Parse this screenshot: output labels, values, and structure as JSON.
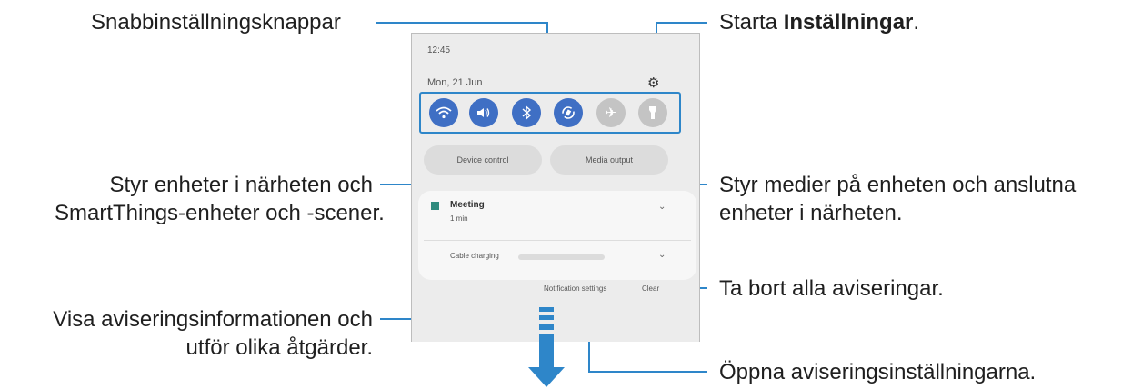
{
  "callouts": {
    "quick_buttons": "Snabbinställningsknappar",
    "settings_prefix": "Starta ",
    "settings_bold": "Inställningar",
    "settings_suffix": ".",
    "nearby_line1": "Styr enheter i närheten och",
    "nearby_line2": "SmartThings-enheter och -scener.",
    "media_line1": "Styr medier på enheten och anslutna",
    "media_line2": "enheter i närheten.",
    "clear": "Ta bort alla aviseringar.",
    "notif_info_line1": "Visa aviseringsinformationen och",
    "notif_info_line2": "utför olika åtgärder.",
    "notif_settings": "Öppna aviseringsinställningarna."
  },
  "panel": {
    "time": "12:45",
    "date": "Mon, 21 Jun",
    "device_control": "Device control",
    "media_output": "Media output",
    "notif_title": "Meeting",
    "notif_sub": "1 min",
    "charging": "Cable charging",
    "notification_settings": "Notification settings",
    "clear": "Clear"
  },
  "quick_buttons": [
    {
      "icon": "wifi-icon",
      "state": "on"
    },
    {
      "icon": "sound-icon",
      "state": "on"
    },
    {
      "icon": "bluetooth-icon",
      "state": "on"
    },
    {
      "icon": "auto-rotate-icon",
      "state": "on"
    },
    {
      "icon": "airplane-icon",
      "state": "off"
    },
    {
      "icon": "flashlight-icon",
      "state": "off"
    }
  ],
  "colors": {
    "accent": "#2e86c9",
    "button_on": "#3f6fc4",
    "button_off": "#c4c4c4"
  }
}
